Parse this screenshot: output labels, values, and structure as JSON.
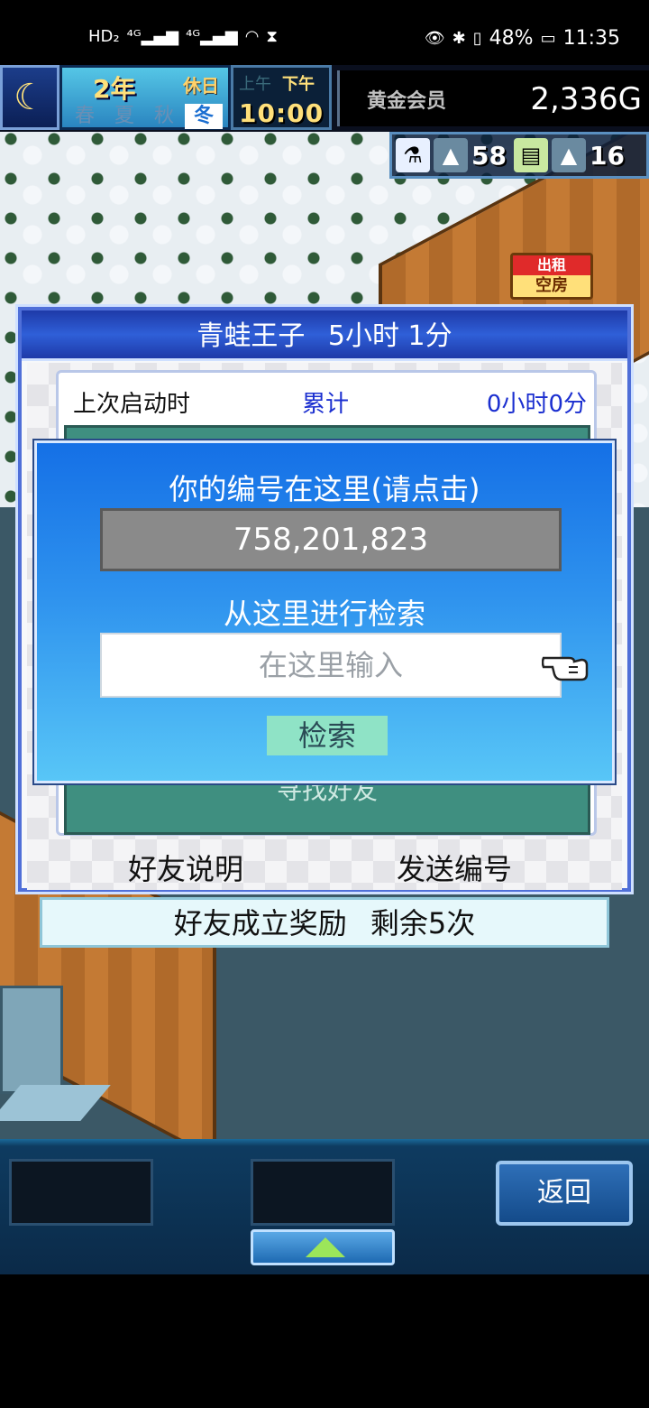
{
  "status_bar": {
    "left_icons": [
      "HD",
      "4G",
      "4G",
      "wifi",
      "hourglass"
    ],
    "battery": "48%",
    "time": "11:35"
  },
  "hud": {
    "year_number": "2",
    "year_unit": "年",
    "holiday": "休日",
    "seasons": [
      "春",
      "夏",
      "秋",
      "冬"
    ],
    "active_season": "冬",
    "am": "上午",
    "pm": "下午",
    "clock": "10:00",
    "gold_label": "黄金会员",
    "gold_value": "2,336G"
  },
  "resources": [
    {
      "icon": "flask-icon",
      "value": ""
    },
    {
      "icon": "mountain-icon",
      "value": "58"
    },
    {
      "icon": "ticket-icon",
      "value": ""
    },
    {
      "icon": "tree-icon",
      "value": "16"
    }
  ],
  "rent_sign": {
    "top": "出租",
    "bottom": "空房"
  },
  "panel": {
    "title_name": "青蛙王子",
    "title_time": "5小时 1分",
    "last_launch_label": "上次启动时",
    "cumulative_label": "累计",
    "cumulative_value": "0小时0分",
    "find_friend": "寻找好友",
    "friend_explain": "好友说明",
    "send_id": "发送编号"
  },
  "reward_bar": {
    "label": "好友成立奖励",
    "remaining": "剩余5次"
  },
  "dialog": {
    "title": "你的编号在这里(请点击)",
    "id_value": "758,201,823",
    "search_label": "从这里进行检索",
    "search_placeholder": "在这里输入",
    "search_button": "检索"
  },
  "bottom_bar": {
    "back_label": "返回"
  },
  "colors": {
    "dialog_top": "#1570e6",
    "dialog_bottom": "#58c6f7",
    "panel_border": "#4f6fd8",
    "accent_blue": "#1b2fd0",
    "teal": "#3f8f80"
  }
}
